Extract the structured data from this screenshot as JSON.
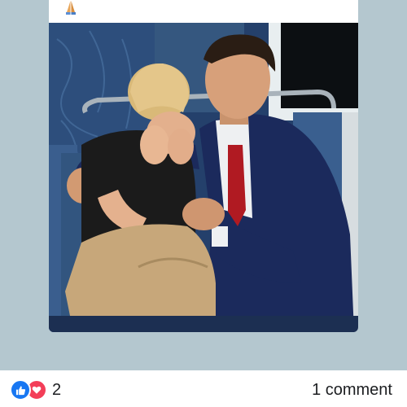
{
  "post": {
    "text_emoji_icon": "folded-hands-icon",
    "photo": {
      "icon": "photo",
      "colors": {
        "seat_blue": "#2c4f7f",
        "suit_navy": "#1b2a5c",
        "tie_red": "#b01a22",
        "pants_khaki": "#c7a77a",
        "shirt_black": "#1b1b1b"
      }
    }
  },
  "footer": {
    "reactions": {
      "icons": [
        "like-icon",
        "love-icon"
      ],
      "count": "2",
      "colors": {
        "like": "#1877f2",
        "love": "#f33e58"
      }
    },
    "comments_label": "1 comment"
  }
}
